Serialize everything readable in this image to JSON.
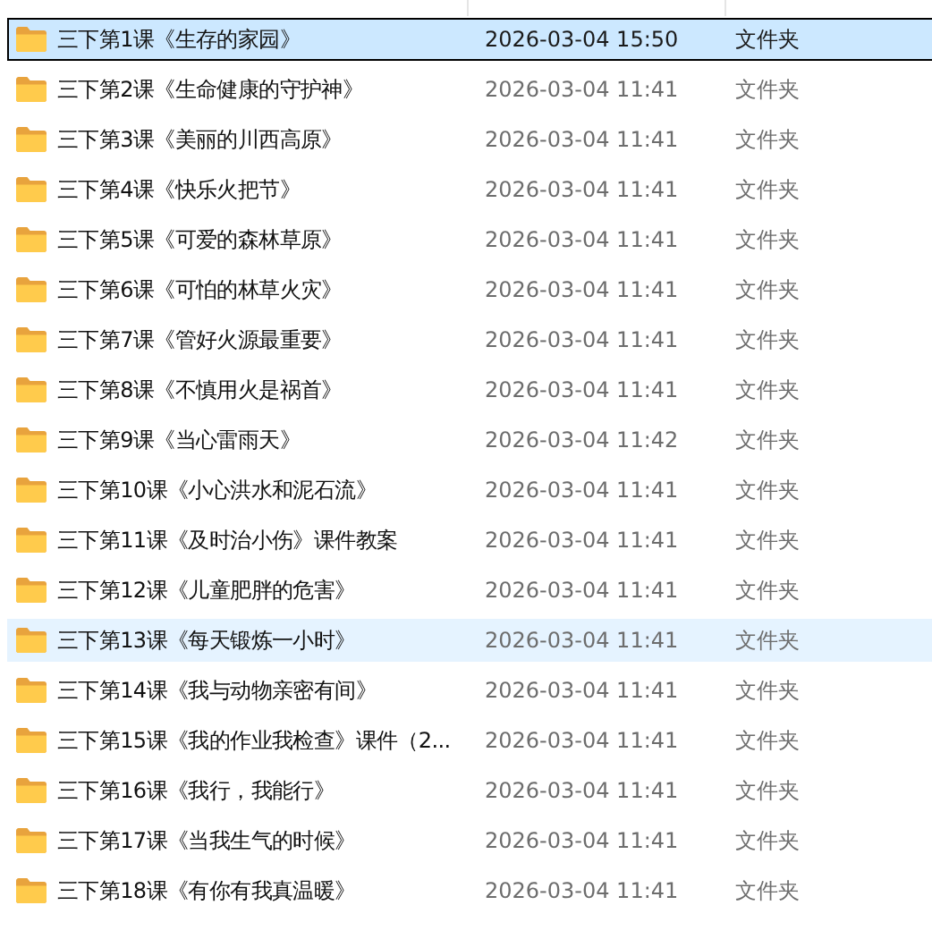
{
  "rows": [
    {
      "name": "三下第1课《生存的家园》",
      "date": "2026-03-04 15:50",
      "type": "文件夹",
      "selected": true,
      "hovered": false
    },
    {
      "name": "三下第2课《生命健康的守护神》",
      "date": "2026-03-04 11:41",
      "type": "文件夹",
      "selected": false,
      "hovered": false
    },
    {
      "name": "三下第3课《美丽的川西高原》",
      "date": "2026-03-04 11:41",
      "type": "文件夹",
      "selected": false,
      "hovered": false
    },
    {
      "name": "三下第4课《快乐火把节》",
      "date": "2026-03-04 11:41",
      "type": "文件夹",
      "selected": false,
      "hovered": false
    },
    {
      "name": "三下第5课《可爱的森林草原》",
      "date": "2026-03-04 11:41",
      "type": "文件夹",
      "selected": false,
      "hovered": false
    },
    {
      "name": "三下第6课《可怕的林草火灾》",
      "date": "2026-03-04 11:41",
      "type": "文件夹",
      "selected": false,
      "hovered": false
    },
    {
      "name": "三下第7课《管好火源最重要》",
      "date": "2026-03-04 11:41",
      "type": "文件夹",
      "selected": false,
      "hovered": false
    },
    {
      "name": "三下第8课《不慎用火是祸首》",
      "date": "2026-03-04 11:41",
      "type": "文件夹",
      "selected": false,
      "hovered": false
    },
    {
      "name": "三下第9课《当心雷雨天》",
      "date": "2026-03-04 11:42",
      "type": "文件夹",
      "selected": false,
      "hovered": false
    },
    {
      "name": "三下第10课《小心洪水和泥石流》",
      "date": "2026-03-04 11:41",
      "type": "文件夹",
      "selected": false,
      "hovered": false
    },
    {
      "name": "三下第11课《及时治小伤》课件教案",
      "date": "2026-03-04 11:41",
      "type": "文件夹",
      "selected": false,
      "hovered": false
    },
    {
      "name": "三下第12课《儿童肥胖的危害》",
      "date": "2026-03-04 11:41",
      "type": "文件夹",
      "selected": false,
      "hovered": false
    },
    {
      "name": "三下第13课《每天锻炼一小时》",
      "date": "2026-03-04 11:41",
      "type": "文件夹",
      "selected": false,
      "hovered": true
    },
    {
      "name": "三下第14课《我与动物亲密有间》",
      "date": "2026-03-04 11:41",
      "type": "文件夹",
      "selected": false,
      "hovered": false
    },
    {
      "name": "三下第15课《我的作业我检查》课件（2...",
      "date": "2026-03-04 11:41",
      "type": "文件夹",
      "selected": false,
      "hovered": false
    },
    {
      "name": "三下第16课《我行，我能行》",
      "date": "2026-03-04 11:41",
      "type": "文件夹",
      "selected": false,
      "hovered": false
    },
    {
      "name": "三下第17课《当我生气的时候》",
      "date": "2026-03-04 11:41",
      "type": "文件夹",
      "selected": false,
      "hovered": false
    },
    {
      "name": "三下第18课《有你有我真温暖》",
      "date": "2026-03-04 11:41",
      "type": "文件夹",
      "selected": false,
      "hovered": false
    }
  ]
}
